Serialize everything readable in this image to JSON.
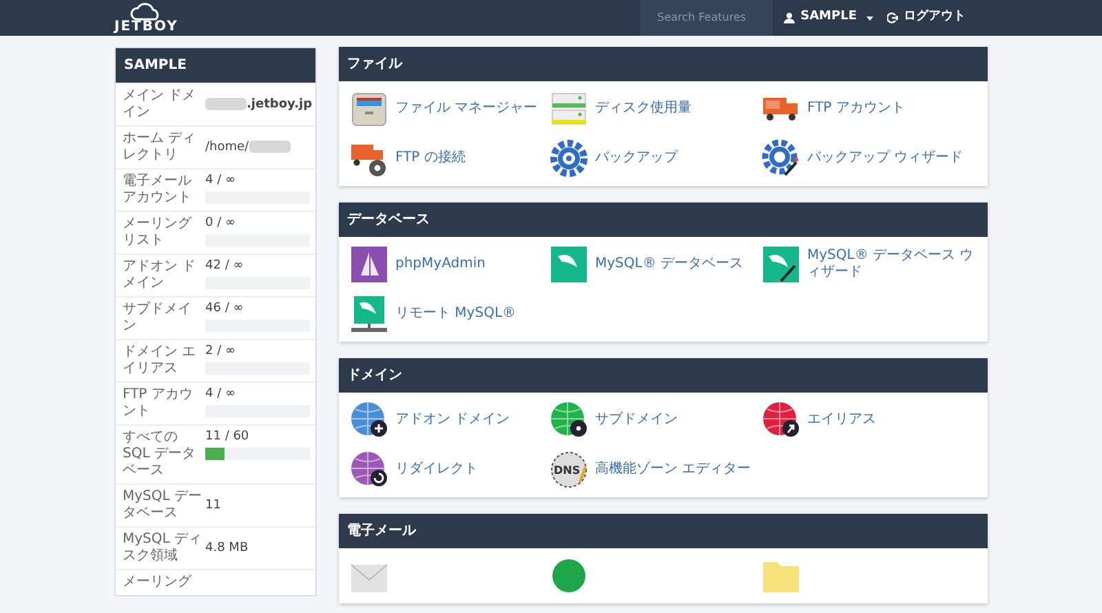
{
  "navbar": {
    "logo": "JETBOY",
    "search": {
      "placeholder": "Search Features"
    },
    "user": "SAMPLE",
    "logout": "ログアウト"
  },
  "sidebar": {
    "title": "SAMPLE",
    "rows": [
      {
        "label": "メイン ドメイン",
        "value": ".jetboy.jp",
        "blurred_before": true
      },
      {
        "label": "ホーム ディレクトリ",
        "value": "/home/",
        "blurred_after": true
      },
      {
        "label": "電子メールアカウント",
        "value": "4 / ∞",
        "level": 0
      },
      {
        "label": "メーリングリスト",
        "value": "0 / ∞",
        "level": 0
      },
      {
        "label": "アドオン ドメイン",
        "value": "42 / ∞",
        "level": 0
      },
      {
        "label": "サブドメイン",
        "value": "46 / ∞",
        "level": 0
      },
      {
        "label": "ドメイン エイリアス",
        "value": "2 / ∞",
        "level": 0
      },
      {
        "label": "FTP アカウント",
        "value": "4 / ∞",
        "level": 0
      },
      {
        "label": "すべての SQL データベース",
        "value": "11 / 60",
        "level": 0.18
      },
      {
        "label": "MySQL データベース",
        "value": "11"
      },
      {
        "label": "MySQL ディスク領域",
        "value": "4.8 MB"
      },
      {
        "label": "メーリング"
      }
    ]
  },
  "panels": [
    {
      "title": "ファイル",
      "items": [
        {
          "kind": "filemanager",
          "label": "ファイル マネージャー"
        },
        {
          "kind": "disk",
          "label": "ディスク使用量"
        },
        {
          "kind": "ftp",
          "label": "FTP アカウント"
        },
        {
          "kind": "ftpconnect",
          "label": "FTP の接続"
        },
        {
          "kind": "backup",
          "label": "バックアップ"
        },
        {
          "kind": "backupwizard",
          "label": "バックアップ ウィザード"
        }
      ]
    },
    {
      "title": "データベース",
      "items": [
        {
          "kind": "phpmyadmin",
          "label": "phpMyAdmin"
        },
        {
          "kind": "mysql",
          "label": "MySQL® データベース"
        },
        {
          "kind": "mysqlwizard",
          "label": "MySQL® データベース ウィザード"
        },
        {
          "kind": "remotemysql",
          "label": "リモート MySQL®"
        }
      ]
    },
    {
      "title": "ドメイン",
      "items": [
        {
          "kind": "addon",
          "color": "#4a8fd6",
          "label": "アドオン ドメイン"
        },
        {
          "kind": "subdomain",
          "color": "#1fb34a",
          "label": "サブドメイン"
        },
        {
          "kind": "alias",
          "color": "#e0203c",
          "label": "エイリアス"
        },
        {
          "kind": "redirect",
          "color": "#9b59b6",
          "label": "リダイレクト"
        },
        {
          "kind": "dns",
          "icon_text": "DNS",
          "label": "高機能ゾーン エディター"
        }
      ]
    },
    {
      "title": "電子メール",
      "items": [
        {
          "kind": "envelope"
        },
        {
          "kind": "greencircle"
        },
        {
          "kind": "folder"
        }
      ]
    }
  ]
}
